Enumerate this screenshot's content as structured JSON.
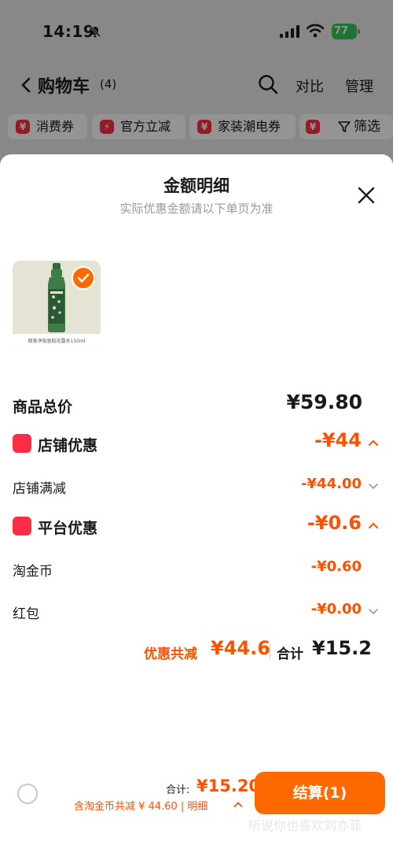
{
  "status_bar": {
    "time": "14:19",
    "battery": "77"
  },
  "nav": {
    "title": "购物车",
    "count": "(4)",
    "compare": "对比",
    "manage": "管理"
  },
  "chips": [
    {
      "icon": "¥",
      "label": "消费券"
    },
    {
      "icon": "⚡",
      "label": "官方立减"
    },
    {
      "icon": "¥",
      "label": "家装潮电券"
    }
  ],
  "filter_label": "筛选",
  "sheet": {
    "title": "金额明细",
    "subtitle": "实际优惠金额请以下单页为准",
    "product": {
      "caption": "郁美净兔驱蚊花露水150ml"
    },
    "rows": {
      "total_price": {
        "label": "商品总价",
        "value": "¥59.80"
      },
      "store_discount": {
        "label": "店铺优惠",
        "value": "-¥44"
      },
      "store_full_reduction": {
        "label": "店铺满减",
        "value": "-¥44.00"
      },
      "platform_discount": {
        "label": "平台优惠",
        "value": "-¥0.6"
      },
      "taojin_coin": {
        "label": "淘金币",
        "value": "-¥0.60"
      },
      "red_packet": {
        "label": "红包",
        "value": "-¥0.00"
      }
    },
    "summary": {
      "discount_label": "优惠共减",
      "discount_value": "¥44.6",
      "total_label": "合计",
      "total_value": "¥15.2"
    }
  },
  "bottom_bar": {
    "total_label": "合计:",
    "total_value": "¥15.20",
    "detail": "含淘金币共减 ¥ 44.60 | 明细",
    "checkout": "结算(1)",
    "watermark": "听说你也喜欢刘亦菲"
  },
  "colors": {
    "accent": "#ff5000",
    "checkout": "#ff6a00",
    "badge_red": "#ff2d44"
  }
}
